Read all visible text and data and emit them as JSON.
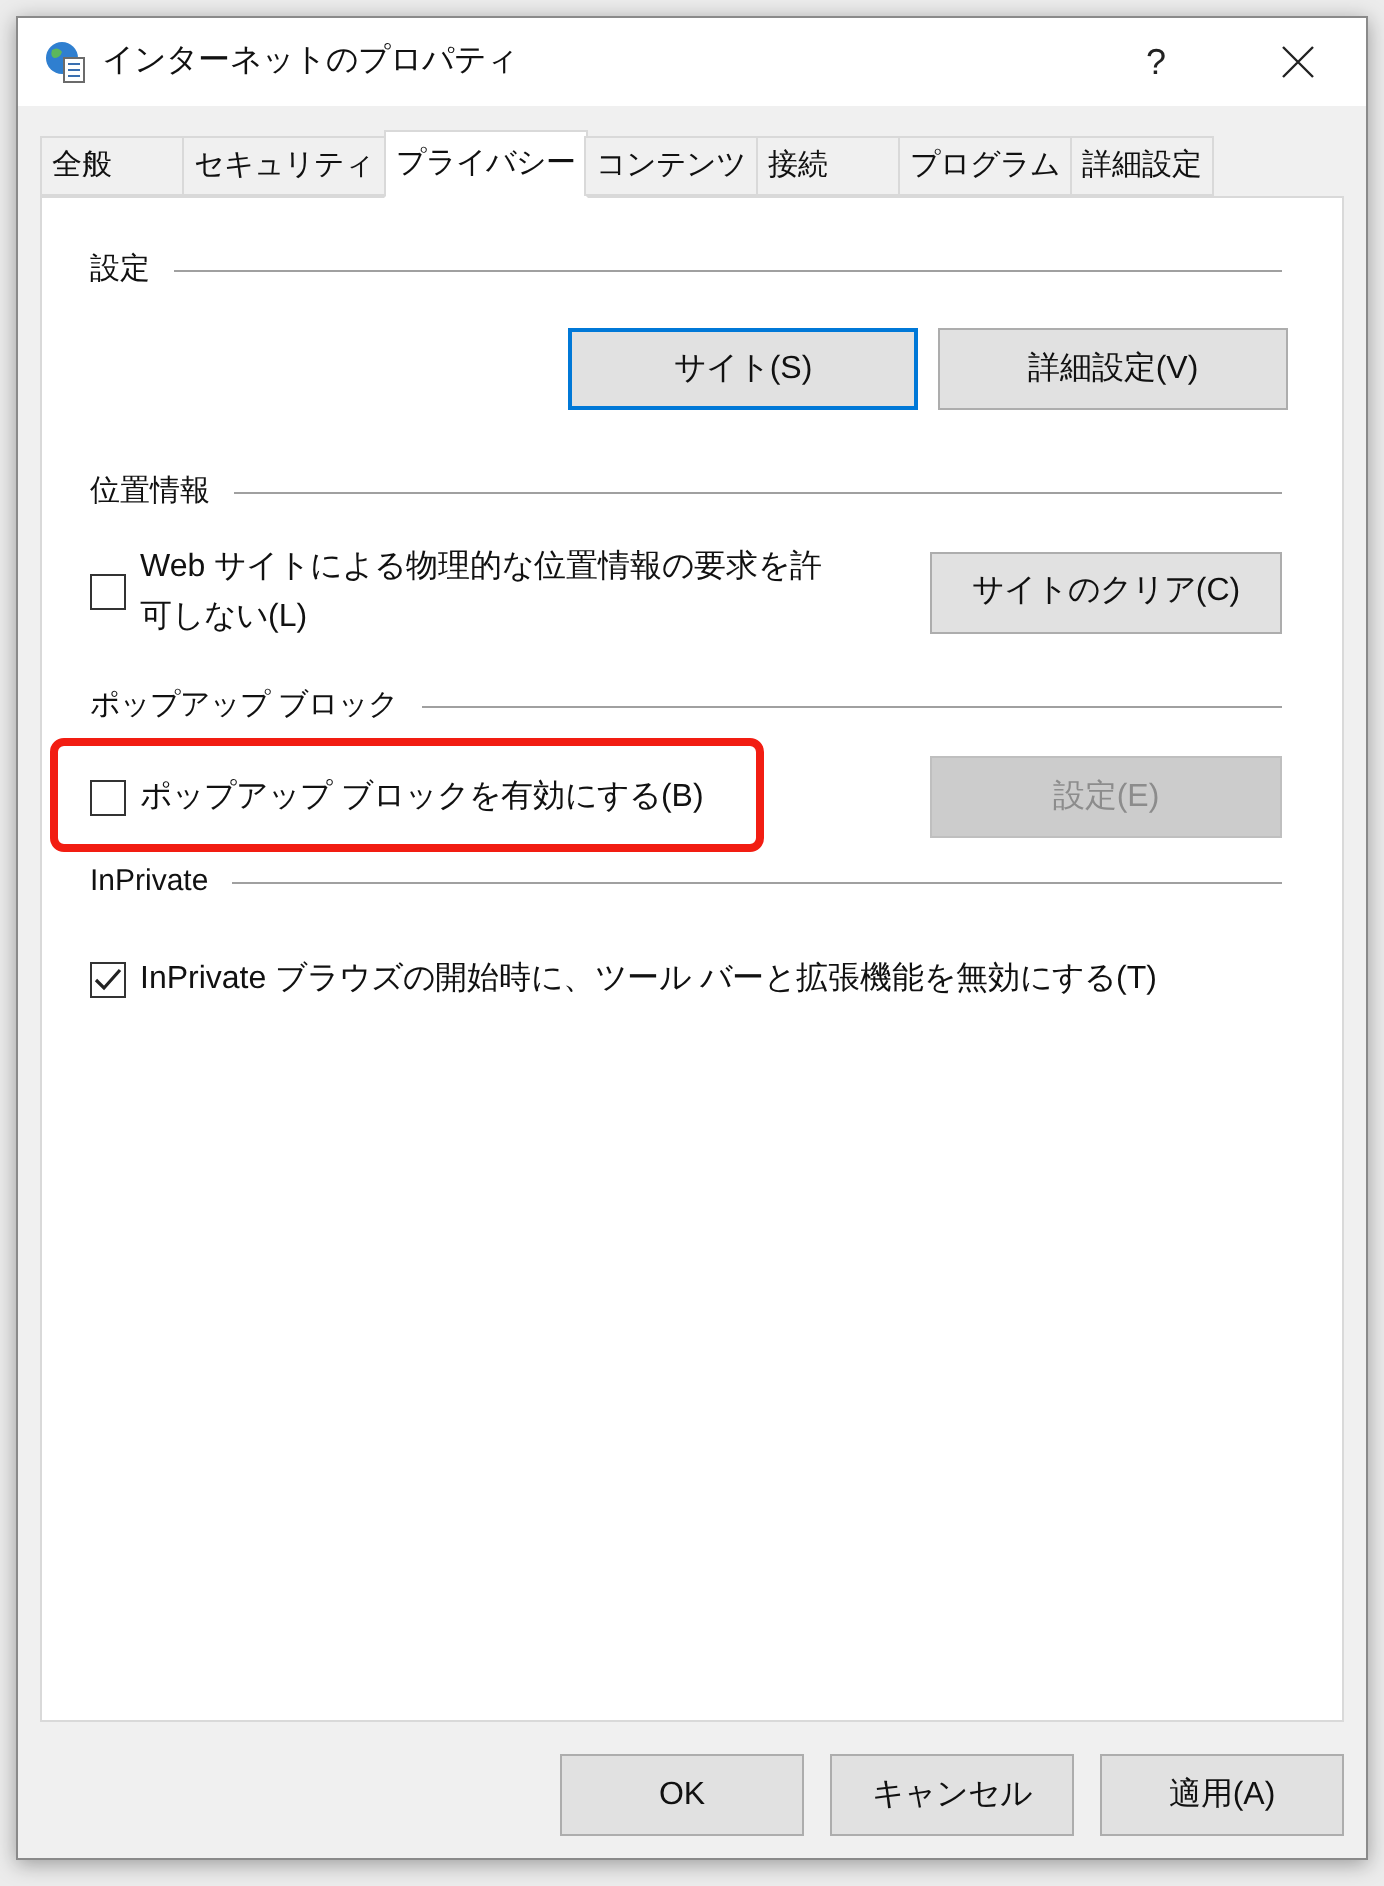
{
  "window": {
    "title": "インターネットのプロパティ",
    "help": "?"
  },
  "tabs": [
    {
      "label": "全般",
      "selected": false
    },
    {
      "label": "セキュリティ",
      "selected": false
    },
    {
      "label": "プライバシー",
      "selected": true
    },
    {
      "label": "コンテンツ",
      "selected": false
    },
    {
      "label": "接続",
      "selected": false
    },
    {
      "label": "プログラム",
      "selected": false
    },
    {
      "label": "詳細設定",
      "selected": false
    }
  ],
  "sections": [
    {
      "title": "設定",
      "kind": "buttons",
      "buttons": [
        {
          "label": "サイト(S)",
          "focused": true
        },
        {
          "label": "詳細設定(V)",
          "focused": false
        }
      ]
    },
    {
      "title": "位置情報",
      "kind": "checkbox-button",
      "checkbox": {
        "label": "Web サイトによる物理的な位置情報の要求を許可しない(L)",
        "checked": false,
        "highlighted": false
      },
      "button": {
        "label": "サイトのクリア(C)",
        "disabled": false
      }
    },
    {
      "title": "ポップアップ ブロック",
      "kind": "checkbox-button",
      "checkbox": {
        "label": "ポップアップ ブロックを有効にする(B)",
        "checked": false,
        "highlighted": true
      },
      "button": {
        "label": "設定(E)",
        "disabled": true
      }
    },
    {
      "title": "InPrivate",
      "kind": "checkbox",
      "checkbox": {
        "label": "InPrivate ブラウズの開始時に、ツール バーと拡張機能を無効にする(T)",
        "checked": true,
        "highlighted": false
      }
    }
  ],
  "footer_buttons": [
    "OK",
    "キャンセル",
    "適用(A)"
  ]
}
